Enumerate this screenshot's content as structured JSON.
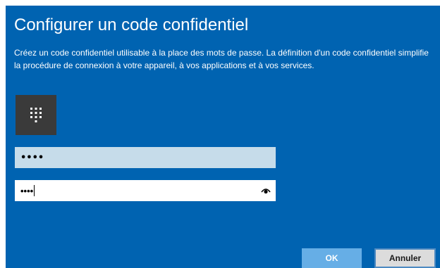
{
  "dialog": {
    "title": "Configurer un code confidentiel",
    "description": "Créez un code confidentiel utilisable à la place des mots de passe. La définition d'un code confidentiel simplifie la procédure de connexion à votre appareil, à vos applications et à vos services.",
    "icon": "keypad-icon"
  },
  "fields": {
    "pin_masked": "••••",
    "confirm_masked": "••••",
    "reveal_icon": "eye-icon"
  },
  "buttons": {
    "ok_label": "OK",
    "cancel_label": "Annuler"
  },
  "colors": {
    "background": "#0063b1",
    "field_filled": "#c6dcea",
    "ok_button": "#66aee6",
    "cancel_button": "#dcdcdc"
  }
}
